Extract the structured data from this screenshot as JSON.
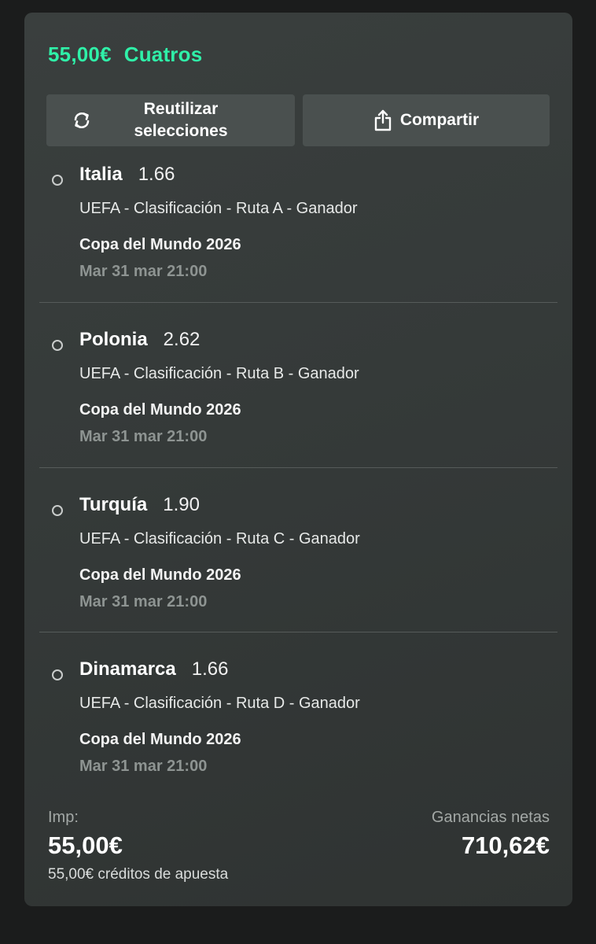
{
  "bet": {
    "stake_title": "55,00€",
    "type": "Cuatros"
  },
  "actions": {
    "reuse_line1": "Reutilizar",
    "reuse_line2": "selecciones",
    "reuse_icon": "refresh-icon",
    "share_label": "Compartir",
    "share_icon": "share-icon"
  },
  "selections": [
    {
      "team": "Italia",
      "odds": "1.66",
      "market": "UEFA - Clasificación - Ruta A - Ganador",
      "event": "Copa del Mundo 2026",
      "date": "Mar 31 mar 21:00"
    },
    {
      "team": "Polonia",
      "odds": "2.62",
      "market": "UEFA - Clasificación - Ruta B - Ganador",
      "event": "Copa del Mundo 2026",
      "date": "Mar 31 mar 21:00"
    },
    {
      "team": "Turquía",
      "odds": "1.90",
      "market": "UEFA - Clasificación - Ruta C - Ganador",
      "event": "Copa del Mundo 2026",
      "date": "Mar 31 mar 21:00"
    },
    {
      "team": "Dinamarca",
      "odds": "1.66",
      "market": "UEFA - Clasificación - Ruta D - Ganador",
      "event": "Copa del Mundo 2026",
      "date": "Mar 31 mar 21:00"
    }
  ],
  "summary": {
    "stake_label": "Imp:",
    "stake_value": "55,00€",
    "credits": "55,00€ créditos de apuesta",
    "net_label": "Ganancias netas",
    "net_value": "710,62€"
  },
  "colors": {
    "accent": "#2ff0a8",
    "card_bg": "#383d3c",
    "button_bg": "#4a504f",
    "page_bg": "#1b1c1c"
  }
}
